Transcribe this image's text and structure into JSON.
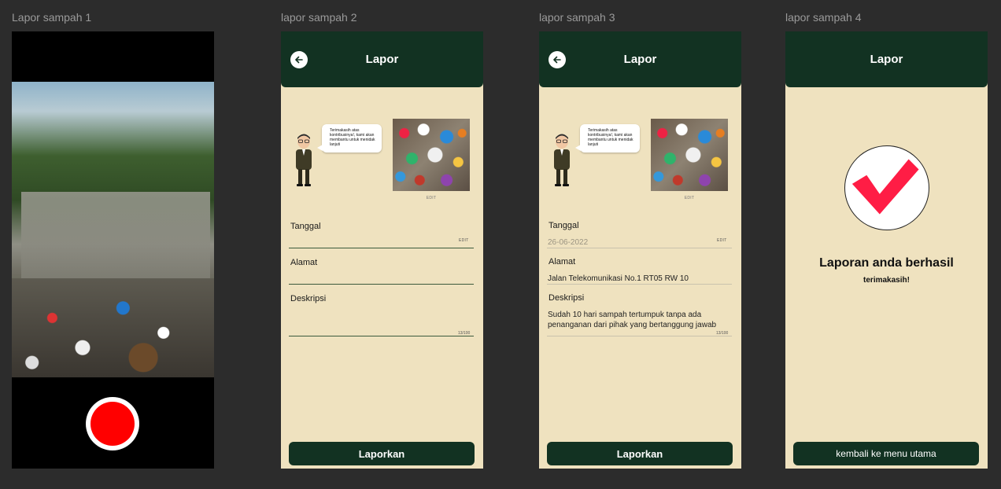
{
  "frames": {
    "f1": {
      "label": "Lapor sampah 1"
    },
    "f2": {
      "label": "lapor sampah 2"
    },
    "f3": {
      "label": "lapor sampah 3"
    },
    "f4": {
      "label": "lapor sampah 4"
    }
  },
  "header": {
    "title": "Lapor"
  },
  "bubble": {
    "text": "Terimakasih atas kontribusinya!, kami akan membantu untuk menidak lanjuti"
  },
  "photo": {
    "edit_label": "EDIT"
  },
  "form": {
    "tanggal_label": "Tanggal",
    "alamat_label": "Alamat",
    "deskripsi_label": "Deskripsi",
    "edit_label": "EDIT",
    "counter": "13/100"
  },
  "filled": {
    "tanggal": "26-06-2022",
    "alamat": "Jalan Telekomunikasi No.1 RT05 RW 10",
    "deskripsi": "Sudah 10 hari sampah tertumpuk tanpa ada penanganan dari pihak yang bertanggung jawab"
  },
  "buttons": {
    "laporkan": "Laporkan",
    "kembali": "kembali ke menu utama"
  },
  "success": {
    "title": "Laporan anda berhasil",
    "subtitle": "terimakasih!"
  },
  "colors": {
    "primary": "#123222",
    "background": "#efe2bf",
    "accent": "#ff1d45",
    "record": "#ff0000"
  },
  "icons": {
    "back": "arrow-left-icon",
    "shutter": "record-button-icon",
    "check": "checkmark-icon"
  }
}
